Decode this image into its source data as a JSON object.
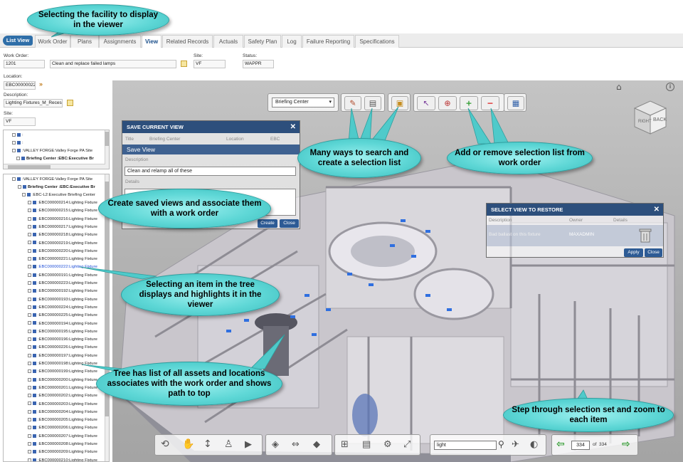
{
  "tabs": {
    "list_view": "List View",
    "items": [
      "Work Order",
      "Plans",
      "Assignments",
      "View",
      "Related Records",
      "Actuals",
      "Safety Plan",
      "Log",
      "Failure Reporting",
      "Specifications"
    ],
    "active": "View"
  },
  "work_order": {
    "wo_label": "Work Order:",
    "wo_value": "1201",
    "desc_value": "Clean and replace failed lamps",
    "site_label": "Site:",
    "site_value": "VF",
    "status_label": "Status:",
    "status_value": "WAPPR",
    "location_label": "Location:",
    "location_value": "EBC00000022",
    "description_label": "Description:",
    "description_value": "Lighting Fixtures_M_Recess",
    "site2_label": "Site:",
    "site2_value": "VF"
  },
  "tree_top": [
    ":",
    ":",
    ":VALLEY FORGE:Valley Forge PA Site",
    "Briefing Center :EBC:Executive Br"
  ],
  "tree_main": {
    "roots": [
      ":VALLEY FORGE:Valley Forge PA Site",
      "Briefing Center :EBC:Executive Br",
      ":EBC-L2:Executive Briefing Center"
    ],
    "items": [
      ":EBC000000214:Lighting Fixture",
      ":EBC000000215:Lighting Fixture",
      ":EBC000000216:Lighting Fixture",
      ":EBC000000217:Lighting Fixture",
      ":EBC000000218:Lighting Fixture",
      ":EBC000000219:Lighting Fixture",
      ":EBC000000220:Lighting Fixture",
      ":EBC000000221:Lighting Fixture",
      ":EBC000000222:Lighting Fixture",
      ":EBC000000191:Lighting Fixture",
      ":EBC000000223:Lighting Fixture",
      ":EBC000000192:Lighting Fixture",
      ":EBC000000193:Lighting Fixture",
      ":EBC000000224:Lighting Fixture",
      ":EBC000000225:Lighting Fixture",
      ":EBC000000194:Lighting Fixture",
      ":EBC000000195:Lighting Fixture",
      ":EBC000000196:Lighting Fixture",
      ":EBC000000226:Lighting Fixture",
      ":EBC000000197:Lighting Fixture",
      ":EBC000000198:Lighting Fixture",
      ":EBC000000199:Lighting Fixture",
      ":EBC000000200:Lighting Fixture",
      ":EBC000000201:Lighting Fixture",
      ":EBC000000202:Lighting Fixture",
      ":EBC000000203:Lighting Fixture",
      ":EBC000000204:Lighting Fixture",
      ":EBC000000205:Lighting Fixture",
      ":EBC000000206:Lighting Fixture",
      ":EBC000000207:Lighting Fixture",
      ":EBC000000208:Lighting Fixture",
      ":EBC000000209:Lighting Fixture",
      ":EBC000000210:Lighting Fixture"
    ],
    "highlighted_index": 8
  },
  "viewer_toolbar": {
    "facility_select": "Briefing Center"
  },
  "save_dialog": {
    "title": "SAVE CURRENT VIEW",
    "close": "✕",
    "col_title": "Title",
    "col_facility": "Briefing Center",
    "col_location": "Location",
    "col_ebc": "EBC",
    "name_value": "Save View",
    "description_label": "Description",
    "description_value": "Clean and relamp all of these",
    "details_label": "Details",
    "create": "Create",
    "close_btn": "Close"
  },
  "restore_dialog": {
    "title": "SELECT VIEW TO RESTORE",
    "close": "✕",
    "col_description": "Description",
    "col_owner": "Owner",
    "col_details": "Details",
    "row_description": "Bad ballast on this fixture",
    "row_owner": "MAXADMIN",
    "apply": "Apply",
    "close_btn": "Close"
  },
  "viewcube": {
    "right": "RIGHT",
    "back": "BACK"
  },
  "bottom_toolbar": {
    "search_value": "light",
    "page_current": "334",
    "page_of": "of",
    "page_total": "334"
  },
  "callouts": {
    "facility": "Selecting the facility to display in the viewer",
    "search": "Many ways to search and create a selection list",
    "addremove": "Add or remove  selection list from work order",
    "savedviews": "Create saved views  and associate them with a work order",
    "treeselect": "Selecting an item in the tree displays and highlights it in the viewer",
    "treelist": "Tree  has list of all assets and locations associates with the work order and shows path to top",
    "step": "Step through selection set and zoom to each item"
  },
  "colors": {
    "accent": "#2d4f7c",
    "callout": "#5ed7d6",
    "highlight": "#1f4fd8"
  }
}
